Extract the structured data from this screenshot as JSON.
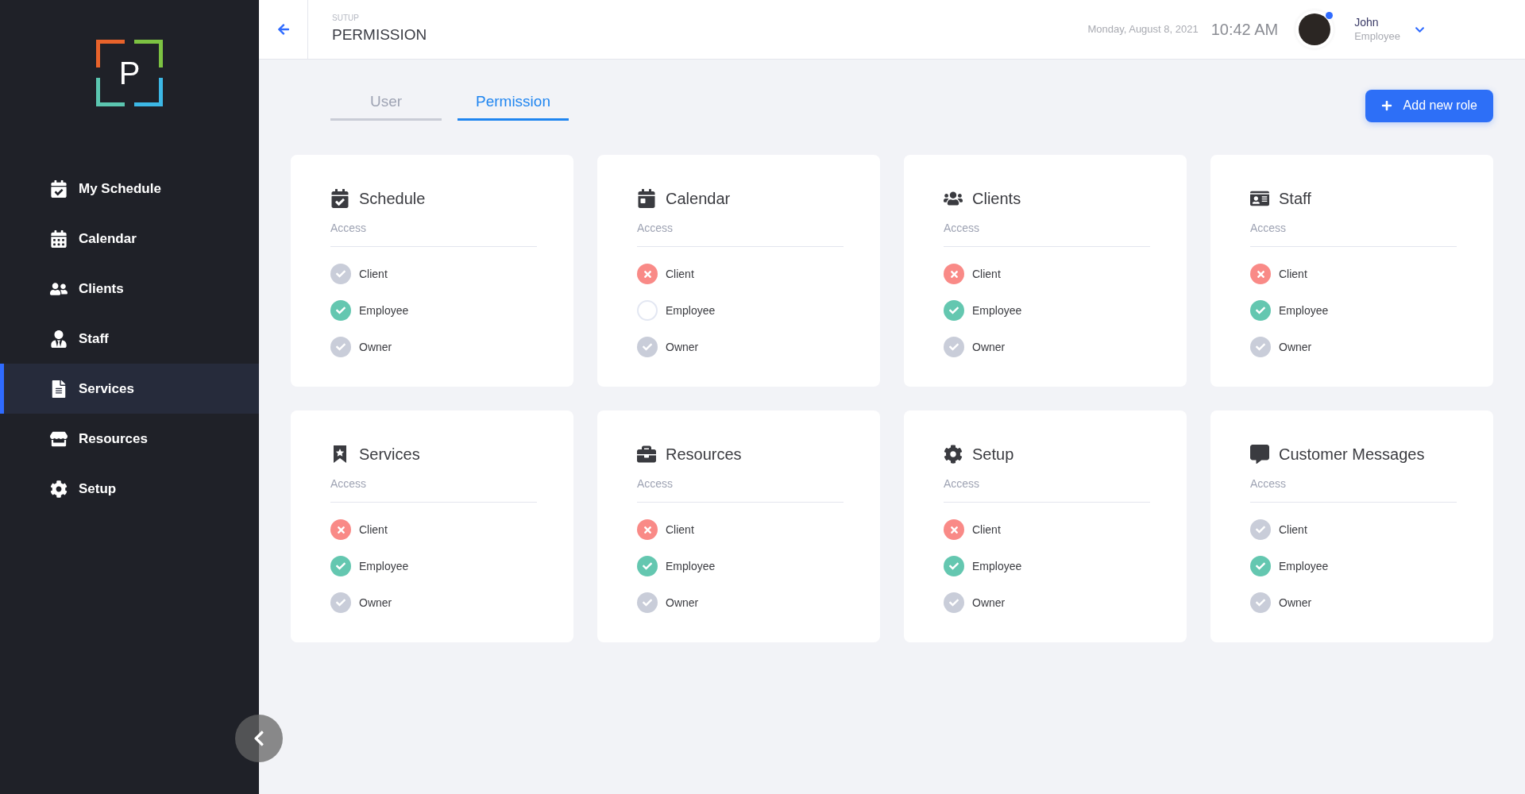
{
  "sidebar": {
    "items": [
      {
        "label": "My Schedule",
        "selected": false
      },
      {
        "label": "Calendar",
        "selected": false
      },
      {
        "label": "Clients",
        "selected": false
      },
      {
        "label": "Staff",
        "selected": false
      },
      {
        "label": "Services",
        "selected": true
      },
      {
        "label": "Resources",
        "selected": false
      },
      {
        "label": "Setup",
        "selected": false
      }
    ]
  },
  "logo": {
    "letter": "P"
  },
  "header": {
    "breadcrumb": "SUTUP",
    "title": "PERMISSION",
    "date": "Monday, August 8, 2021",
    "time": "10:42 AM",
    "user": {
      "name": "John",
      "role": "Employee",
      "online": true
    }
  },
  "tabs": [
    {
      "label": "User",
      "selected": false
    },
    {
      "label": "Permission",
      "selected": true
    }
  ],
  "add_button": "Add new role",
  "cards": [
    {
      "title": "Schedule",
      "subtitle": "Access",
      "roles": [
        {
          "label": "Client",
          "kind": "default"
        },
        {
          "label": "Employee",
          "kind": "granted"
        },
        {
          "label": "Owner",
          "kind": "default"
        }
      ]
    },
    {
      "title": "Calendar",
      "subtitle": "Access",
      "roles": [
        {
          "label": "Client",
          "kind": "denied"
        },
        {
          "label": "Employee",
          "kind": "none"
        },
        {
          "label": "Owner",
          "kind": "default"
        }
      ]
    },
    {
      "title": "Clients",
      "subtitle": "Access",
      "roles": [
        {
          "label": "Client",
          "kind": "denied"
        },
        {
          "label": "Employee",
          "kind": "granted"
        },
        {
          "label": "Owner",
          "kind": "default"
        }
      ]
    },
    {
      "title": "Staff",
      "subtitle": "Access",
      "roles": [
        {
          "label": "Client",
          "kind": "denied"
        },
        {
          "label": "Employee",
          "kind": "granted"
        },
        {
          "label": "Owner",
          "kind": "default"
        }
      ]
    },
    {
      "title": "Services",
      "subtitle": "Access",
      "roles": [
        {
          "label": "Client",
          "kind": "denied"
        },
        {
          "label": "Employee",
          "kind": "granted"
        },
        {
          "label": "Owner",
          "kind": "default"
        }
      ]
    },
    {
      "title": "Resources",
      "subtitle": "Access",
      "roles": [
        {
          "label": "Client",
          "kind": "denied"
        },
        {
          "label": "Employee",
          "kind": "granted"
        },
        {
          "label": "Owner",
          "kind": "default"
        }
      ]
    },
    {
      "title": "Setup",
      "subtitle": "Access",
      "roles": [
        {
          "label": "Client",
          "kind": "denied"
        },
        {
          "label": "Employee",
          "kind": "granted"
        },
        {
          "label": "Owner",
          "kind": "default"
        }
      ]
    },
    {
      "title": "Customer Messages",
      "subtitle": "Access",
      "roles": [
        {
          "label": "Client",
          "kind": "default"
        },
        {
          "label": "Employee",
          "kind": "granted"
        },
        {
          "label": "Owner",
          "kind": "default"
        }
      ]
    }
  ]
}
